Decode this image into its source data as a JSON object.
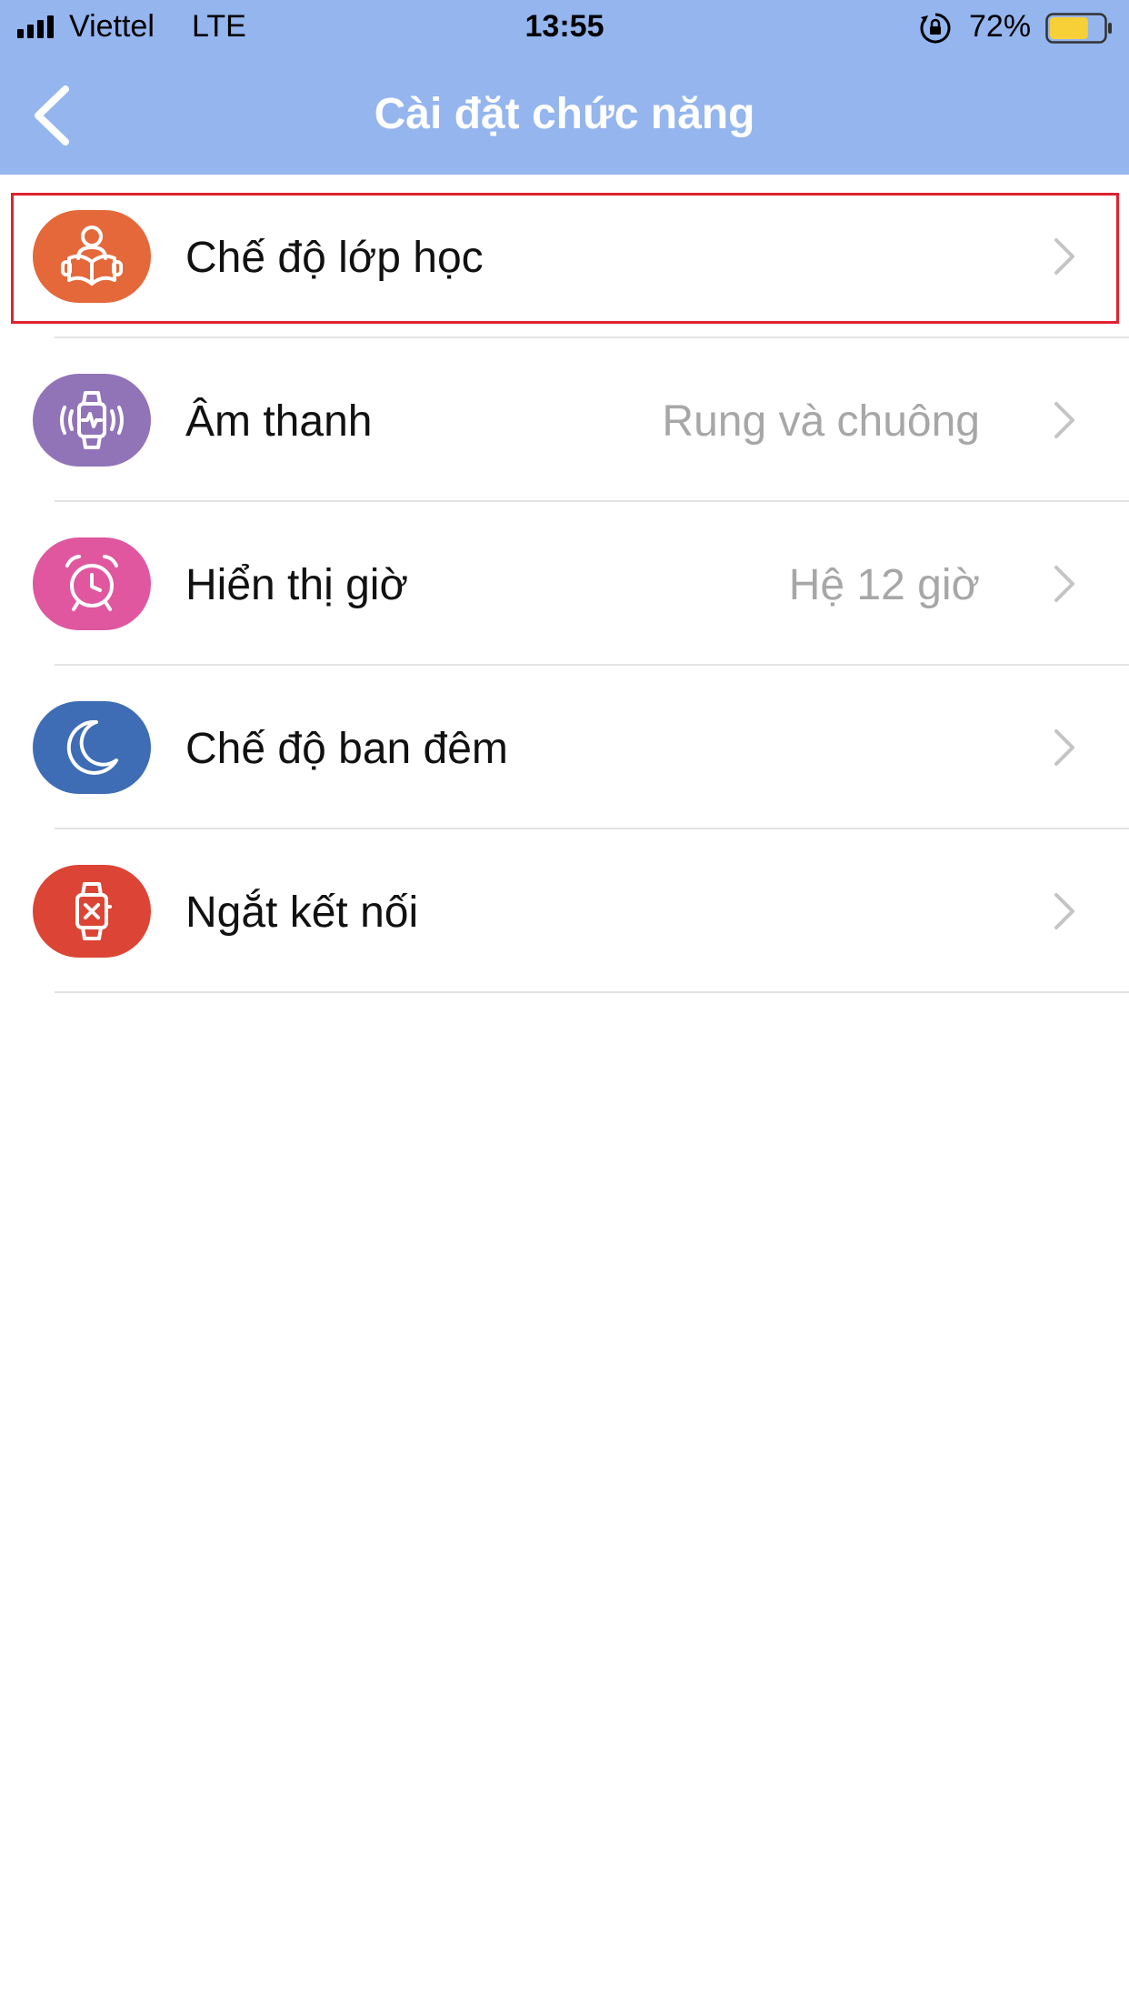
{
  "status_bar": {
    "carrier": "Viettel",
    "network": "LTE",
    "time": "13:55",
    "battery_percent": "72%",
    "battery_level": 0.72,
    "orientation_lock_icon": "rotation-lock-icon"
  },
  "nav": {
    "title": "Cài đặt chức năng",
    "back_icon": "chevron-left-icon"
  },
  "colors": {
    "header_bg": "#94b5ee",
    "highlight_border": "#e0222e",
    "value_text": "#a7a7a7",
    "battery_fill": "#f7d038"
  },
  "settings": [
    {
      "label": "Chế độ lớp học",
      "value": "",
      "icon": "reading-person-icon",
      "icon_color": "#e4683a",
      "highlighted": true
    },
    {
      "label": "Âm thanh",
      "value": "Rung và chuông",
      "icon": "vibrating-watch-icon",
      "icon_color": "#9174b7"
    },
    {
      "label": "Hiển thị giờ",
      "value": "Hệ 12 giờ",
      "icon": "alarm-clock-icon",
      "icon_color": "#e0579f"
    },
    {
      "label": "Chế độ ban đêm",
      "value": "",
      "icon": "moon-icon",
      "icon_color": "#3e6db5"
    },
    {
      "label": "Ngắt kết nối",
      "value": "",
      "icon": "watch-disconnect-icon",
      "icon_color": "#dc4535"
    }
  ]
}
